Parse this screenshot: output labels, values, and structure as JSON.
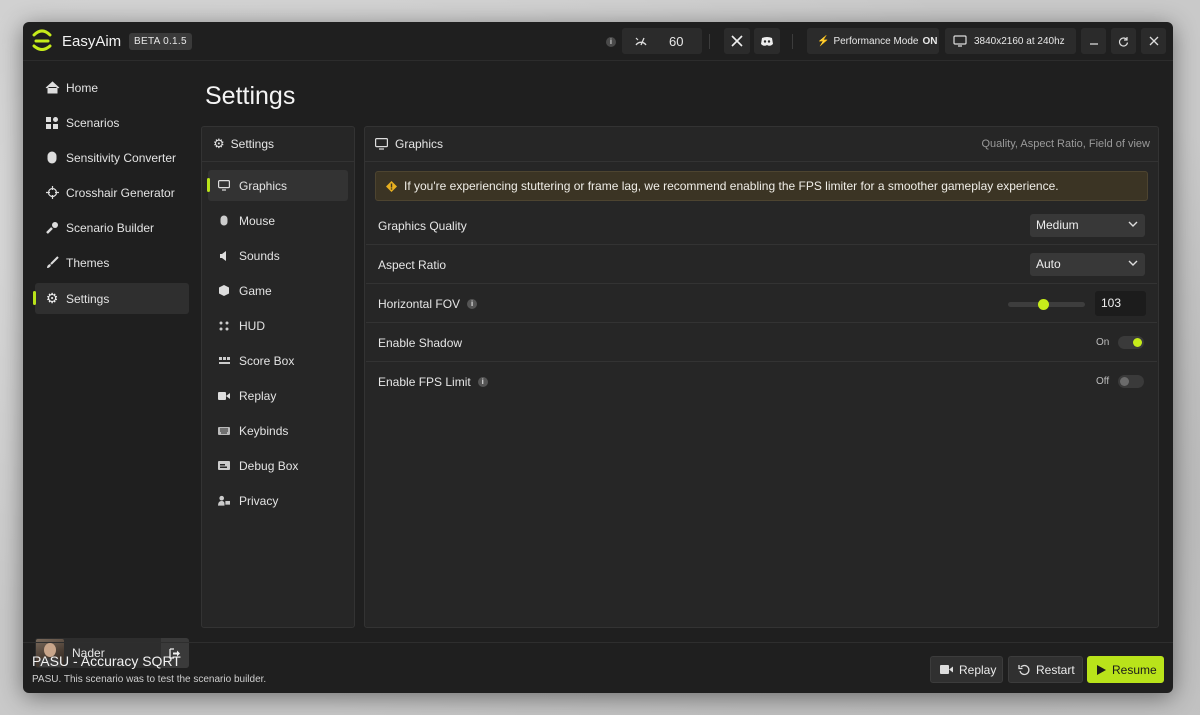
{
  "app": {
    "name": "EasyAim",
    "version_badge": "BETA 0.1.5",
    "accent_color": "#b9e31a"
  },
  "titlebar": {
    "info_icon": "info-icon",
    "fps_icon": "gauge-icon",
    "fps_value": "60",
    "twitter_icon": "x-logo-icon",
    "discord_icon": "discord-icon",
    "performance_label": "Performance Mode",
    "performance_state": "ON",
    "resolution": "3840x2160 at 240hz"
  },
  "sidebar": {
    "items": [
      {
        "label": "Home",
        "icon": "home-icon"
      },
      {
        "label": "Scenarios",
        "icon": "grid-icon"
      },
      {
        "label": "Sensitivity Converter",
        "icon": "mouse-icon"
      },
      {
        "label": "Crosshair Generator",
        "icon": "crosshair-icon"
      },
      {
        "label": "Scenario Builder",
        "icon": "builder-icon"
      },
      {
        "label": "Themes",
        "icon": "brush-icon"
      },
      {
        "label": "Settings",
        "icon": "gear-icon",
        "active": true
      }
    ],
    "user": {
      "name": "Nader"
    }
  },
  "page": {
    "title": "Settings"
  },
  "subnav": {
    "header": "Settings",
    "items": [
      {
        "label": "Graphics",
        "icon": "monitor-icon",
        "active": true
      },
      {
        "label": "Mouse",
        "icon": "mouse-icon"
      },
      {
        "label": "Sounds",
        "icon": "speaker-icon"
      },
      {
        "label": "Game",
        "icon": "cube-icon"
      },
      {
        "label": "HUD",
        "icon": "hud-icon"
      },
      {
        "label": "Score Box",
        "icon": "scorebox-icon"
      },
      {
        "label": "Replay",
        "icon": "video-icon"
      },
      {
        "label": "Keybinds",
        "icon": "keyboard-icon"
      },
      {
        "label": "Debug Box",
        "icon": "debug-icon"
      },
      {
        "label": "Privacy",
        "icon": "user-lock-icon"
      }
    ]
  },
  "content": {
    "title": "Graphics",
    "subtitle": "Quality, Aspect Ratio, Field of view",
    "warning": "If you're experiencing stuttering or frame lag, we recommend enabling the FPS limiter for a smoother gameplay experience.",
    "settings": {
      "graphics_quality": {
        "label": "Graphics Quality",
        "value": "Medium"
      },
      "aspect_ratio": {
        "label": "Aspect Ratio",
        "value": "Auto"
      },
      "horizontal_fov": {
        "label": "Horizontal FOV",
        "value": "103",
        "slider_fraction": 0.45
      },
      "enable_shadow": {
        "label": "Enable Shadow",
        "state": "On"
      },
      "enable_fps_limit": {
        "label": "Enable FPS Limit",
        "state": "Off"
      }
    }
  },
  "footer": {
    "scenario_title": "PASU - Accuracy SQRT",
    "scenario_desc": "PASU. This scenario was to test the scenario builder.",
    "buttons": {
      "replay": "Replay",
      "restart": "Restart",
      "resume": "Resume"
    }
  }
}
